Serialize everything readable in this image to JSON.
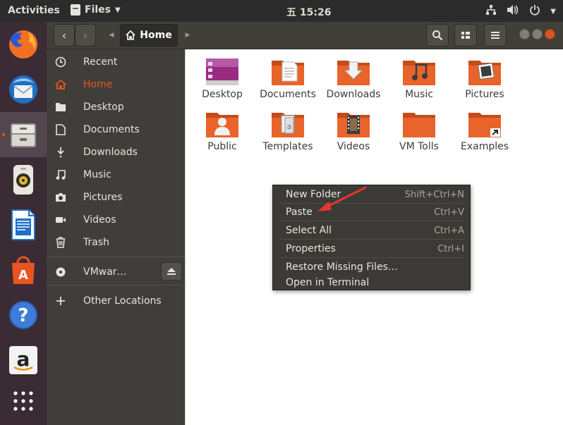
{
  "topbar": {
    "activities": "Activities",
    "app_name": "Files",
    "clock": "五 15:26"
  },
  "dock": {
    "items": [
      "firefox",
      "thunderbird",
      "files",
      "rhythmbox",
      "libreoffice-writer",
      "ubuntu-software",
      "help",
      "amazon",
      "show-applications"
    ]
  },
  "headerbar": {
    "location": "Home"
  },
  "sidebar": {
    "items": [
      {
        "label": "Recent",
        "icon": "clock-icon"
      },
      {
        "label": "Home",
        "icon": "home-icon"
      },
      {
        "label": "Desktop",
        "icon": "folder-icon"
      },
      {
        "label": "Documents",
        "icon": "document-icon"
      },
      {
        "label": "Downloads",
        "icon": "download-icon"
      },
      {
        "label": "Music",
        "icon": "music-icon"
      },
      {
        "label": "Pictures",
        "icon": "camera-icon"
      },
      {
        "label": "Videos",
        "icon": "video-icon"
      },
      {
        "label": "Trash",
        "icon": "trash-icon"
      },
      {
        "label": "VMwar…",
        "icon": "disc-icon"
      },
      {
        "label": "Other Locations",
        "icon": "plus-icon"
      }
    ]
  },
  "files": {
    "items": [
      {
        "name": "Desktop"
      },
      {
        "name": "Documents"
      },
      {
        "name": "Downloads"
      },
      {
        "name": "Music"
      },
      {
        "name": "Pictures"
      },
      {
        "name": "Public"
      },
      {
        "name": "Templates"
      },
      {
        "name": "Videos"
      },
      {
        "name": "VM Tolls"
      },
      {
        "name": "Examples"
      }
    ]
  },
  "context_menu": {
    "items": [
      {
        "label": "New Folder",
        "accel": "Shift+Ctrl+N"
      },
      {
        "label": "Paste",
        "accel": "Ctrl+V"
      },
      {
        "label": "Select All",
        "accel": "Ctrl+A"
      },
      {
        "label": "Properties",
        "accel": "Ctrl+I"
      },
      {
        "label": "Restore Missing Files…",
        "accel": ""
      },
      {
        "label": "Open in Terminal",
        "accel": ""
      }
    ]
  },
  "colors": {
    "accent": "#e95420",
    "folder": "#e8642b",
    "annotation_arrow": "#e8352e"
  }
}
